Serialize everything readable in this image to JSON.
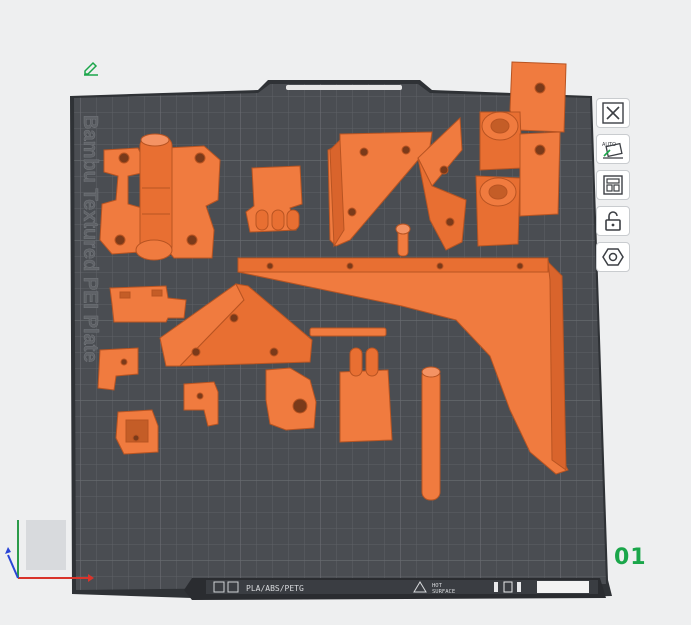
{
  "plate": {
    "label": "Bambu Textured PEI Plate",
    "number": "01",
    "material_label": "PLA/ABS/PETG",
    "warning_line1": "HOT",
    "warning_line2": "SURFACE"
  },
  "toolbar": {
    "items": [
      {
        "name": "close-plate",
        "icon": "close-icon"
      },
      {
        "name": "auto-orient",
        "icon": "auto-orient-icon"
      },
      {
        "name": "arrange",
        "icon": "arrange-icon"
      },
      {
        "name": "lock-plate",
        "icon": "lock-icon"
      },
      {
        "name": "plate-settings",
        "icon": "hexagon-settings-icon"
      }
    ]
  },
  "colors": {
    "background": "#eeeff0",
    "plate": "#4a4d52",
    "grid": "#5e6166",
    "part": "#f07b3f",
    "part_shadow": "#b85422",
    "accent_green": "#1aa64a"
  }
}
